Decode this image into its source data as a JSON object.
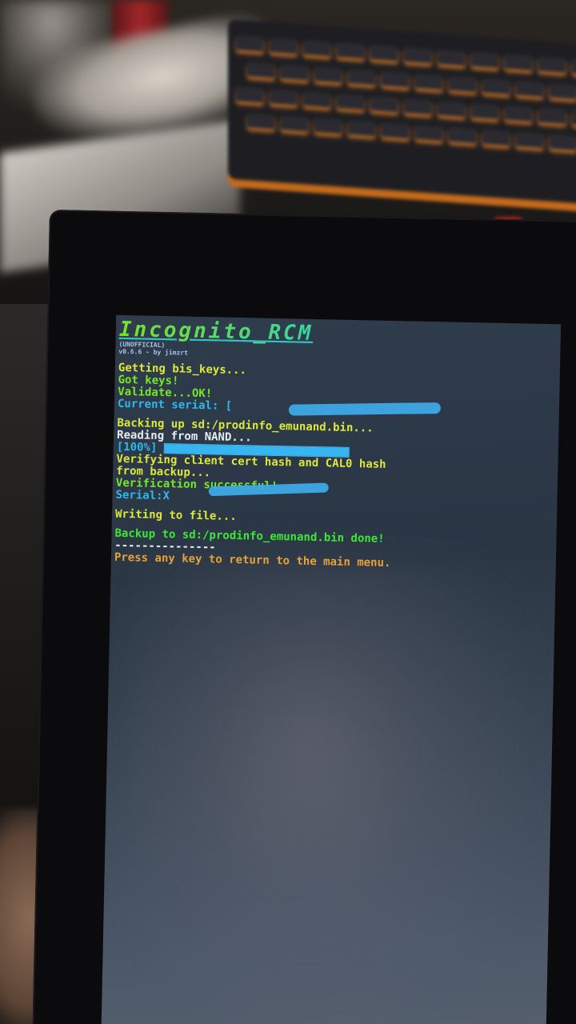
{
  "title": "Incognito_RCM",
  "version_lines": [
    "(UNOFFICIAL)",
    "v0.6.6 - by jimzrt"
  ],
  "lines": {
    "getting_keys": "Getting bis_keys...",
    "got_keys": "Got keys!",
    "validate": "Validate...OK!",
    "current_serial": "Current serial: [",
    "backing_up": "Backing up sd:/prodinfo_emunand.bin...",
    "reading_nand": "Reading from NAND...",
    "progress_label": "[100%]",
    "verifying_1": "Verifying client cert hash and CAL0 hash",
    "verifying_2": "from backup...",
    "verification": "Verification successful!",
    "serial": "Serial:X",
    "writing": "Writing to file...",
    "backup_done": "Backup to sd:/prodinfo_emunand.bin done!",
    "separator": "---------------",
    "press_any_key": "Press any key to return to the main menu."
  },
  "progress": 1.0,
  "colors": {
    "yellow": "#dce83a",
    "lime": "#78e62a",
    "green": "#3fe63a",
    "cyan": "#2fb8ee",
    "orange": "#e6a23a",
    "redaction": "#3ea9e8"
  }
}
